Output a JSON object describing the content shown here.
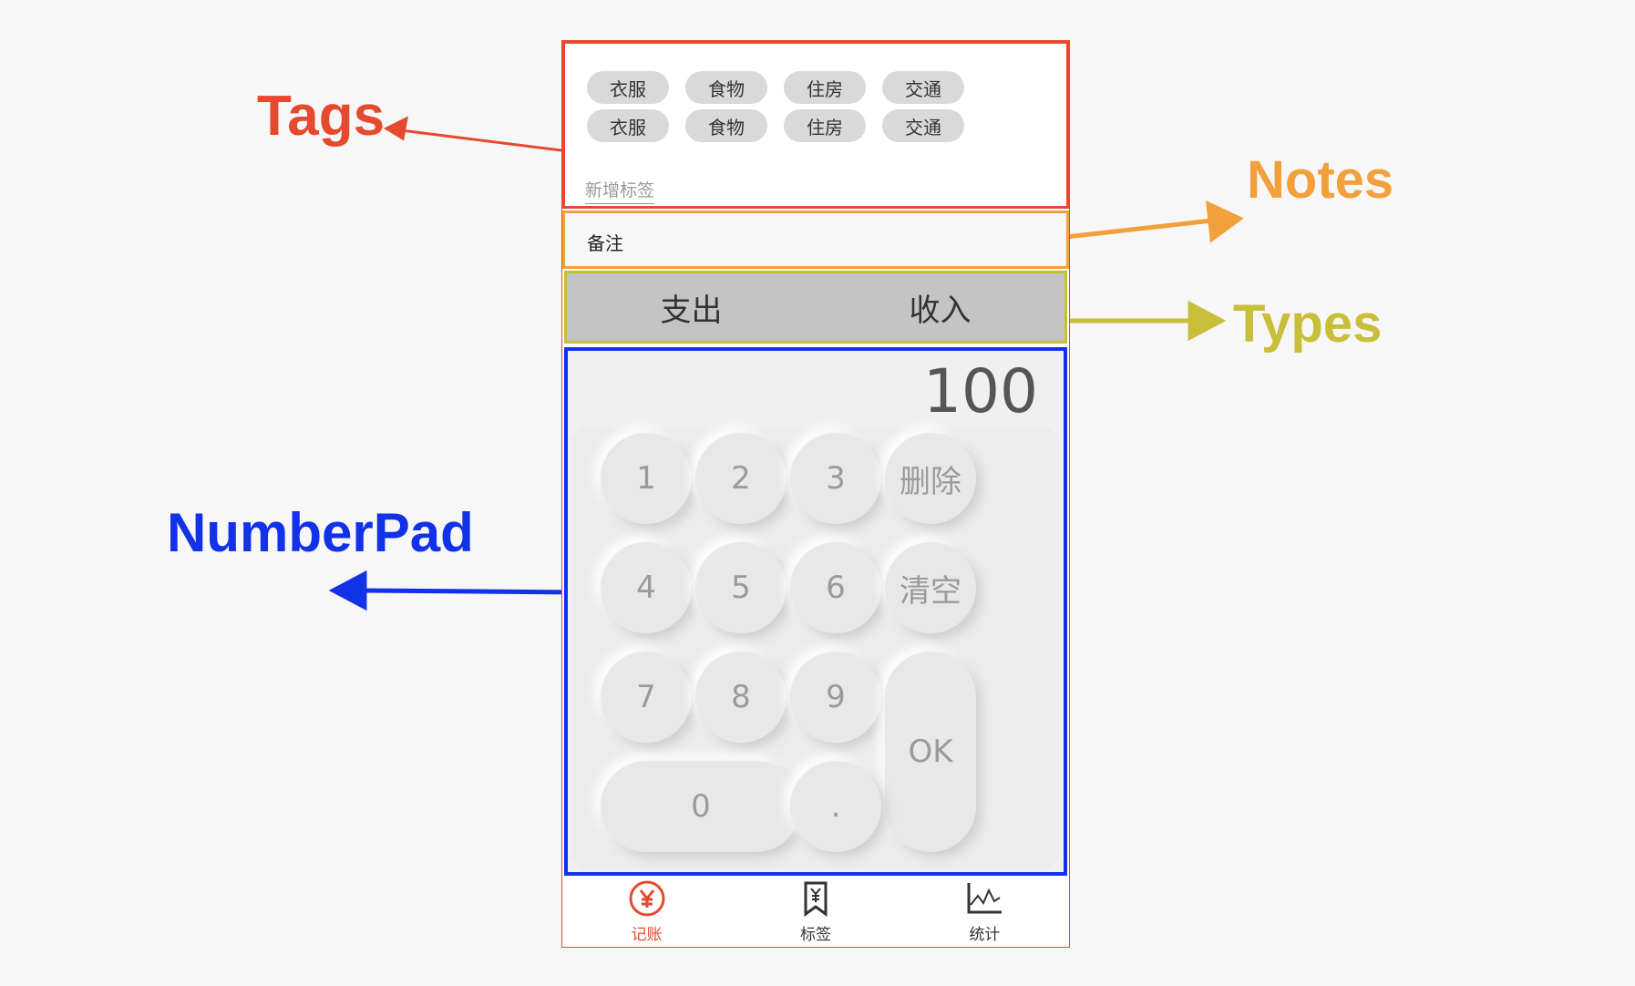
{
  "annotations": {
    "tags": "Tags",
    "notes": "Notes",
    "types": "Types",
    "numberpad": "NumberPad"
  },
  "tags": {
    "items": [
      "衣服",
      "食物",
      "住房",
      "交通",
      "衣服",
      "食物",
      "住房",
      "交通"
    ],
    "new_tag_label": "新增标签"
  },
  "notes": {
    "label": "备注"
  },
  "types": {
    "expense": "支出",
    "income": "收入"
  },
  "numberpad": {
    "amount": "100",
    "keys": {
      "k1": "1",
      "k2": "2",
      "k3": "3",
      "delete": "删除",
      "k4": "4",
      "k5": "5",
      "k6": "6",
      "clear": "清空",
      "k7": "7",
      "k8": "8",
      "k9": "9",
      "ok": "OK",
      "k0": "0",
      "dot": "."
    }
  },
  "tabbar": {
    "items": [
      {
        "label": "记账",
        "icon": "money-icon",
        "active": true
      },
      {
        "label": "标签",
        "icon": "bookmark-icon",
        "active": false
      },
      {
        "label": "统计",
        "icon": "chart-icon",
        "active": false
      }
    ]
  },
  "colors": {
    "tags": "#e64a2e",
    "notes": "#f2a03c",
    "types": "#c8be3a",
    "numberpad": "#1232e8"
  }
}
